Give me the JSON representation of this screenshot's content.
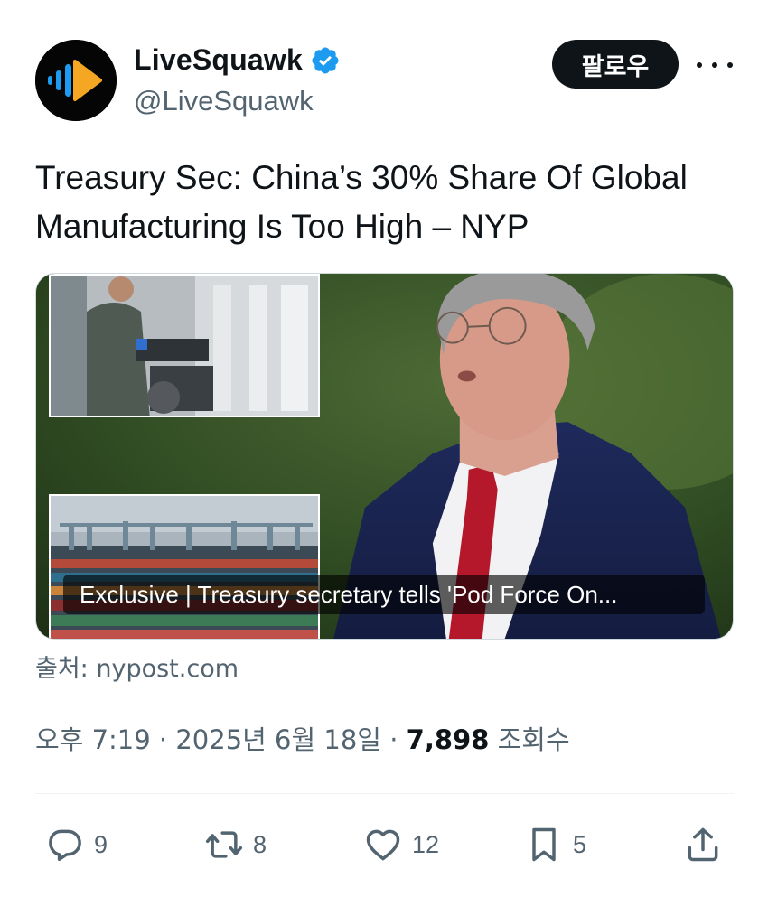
{
  "author": {
    "display_name": "LiveSquawk",
    "handle": "@LiveSquawk",
    "verified": true
  },
  "header": {
    "follow_label": "팔로우"
  },
  "tweet": {
    "text_line1": "Treasury Sec: China’s 30% Share Of Global",
    "text_line2": "Manufacturing Is Too High – NYP"
  },
  "card": {
    "caption": "Exclusive | Treasury secretary tells 'Pod Force On..."
  },
  "source": "출처: nypost.com",
  "meta": {
    "time": "오후 7:19",
    "sep1": " · ",
    "date": "2025년 6월 18일",
    "sep2": " · ",
    "views": "7,898",
    "views_label": " 조회수"
  },
  "actions": {
    "reply_count": "9",
    "retweet_count": "8",
    "like_count": "12",
    "bookmark_count": "5"
  },
  "colors": {
    "text": "#0f1419",
    "secondary": "#536471",
    "verified": "#1d9bf0",
    "logo_orange": "#f5a623",
    "logo_blue": "#1d9bf0"
  }
}
